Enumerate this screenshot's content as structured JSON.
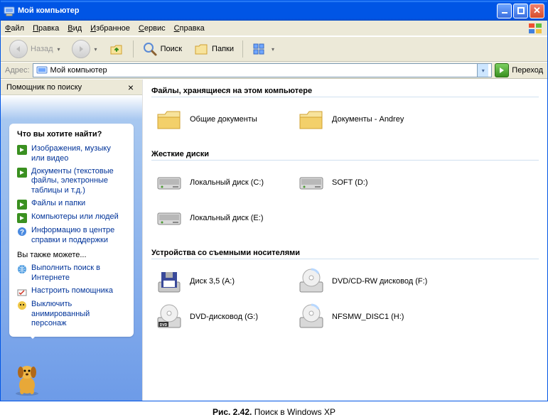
{
  "window": {
    "title": "Мой компьютер"
  },
  "menu": {
    "file": "Файл",
    "edit": "Правка",
    "view": "Вид",
    "favs": "Избранное",
    "tools": "Сервис",
    "help": "Справка"
  },
  "toolbar": {
    "back": "Назад",
    "search": "Поиск",
    "folders": "Папки"
  },
  "address": {
    "label": "Адрес:",
    "value": "Мой компьютер",
    "go": "Переход"
  },
  "sidebar": {
    "header": "Помощник по поиску",
    "panelTitle": "Что вы хотите найти?",
    "links1": [
      "Изображения, музыку или видео",
      "Документы (текстовые файлы, электронные таблицы и т.д.)",
      "Файлы и папки",
      "Компьютеры или людей",
      "Информацию в центре справки и поддержки"
    ],
    "subhead": "Вы также можете...",
    "links2": [
      "Выполнить поиск в Интернете",
      "Настроить помощника",
      "Выключить анимированный персонаж"
    ]
  },
  "groups": [
    {
      "title": "Файлы, хранящиеся на этом компьютере",
      "items": [
        {
          "icon": "folder",
          "label": "Общие документы"
        },
        {
          "icon": "folder",
          "label": "Документы - Andrey"
        }
      ]
    },
    {
      "title": "Жесткие диски",
      "items": [
        {
          "icon": "hdd",
          "label": "Локальный диск (C:)"
        },
        {
          "icon": "hdd",
          "label": "SOFT (D:)"
        },
        {
          "icon": "hdd",
          "label": "Локальный диск (E:)"
        }
      ]
    },
    {
      "title": "Устройства со съемными носителями",
      "items": [
        {
          "icon": "floppy",
          "label": "Диск 3,5 (A:)"
        },
        {
          "icon": "cd",
          "label": "DVD/CD-RW дисковод (F:)"
        },
        {
          "icon": "dvd",
          "label": "DVD-дисковод (G:)"
        },
        {
          "icon": "cd",
          "label": "NFSMW_DISC1 (H:)"
        }
      ]
    }
  ],
  "caption": {
    "bold": "Рис. 2.42.",
    "text": " Поиск в Windows XP"
  }
}
